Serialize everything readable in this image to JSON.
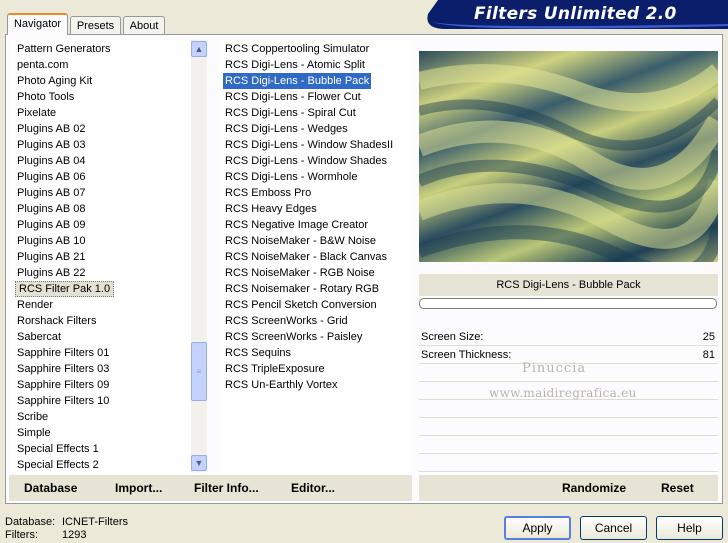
{
  "header": {
    "title": "Filters Unlimited 2.0"
  },
  "tabs": [
    {
      "label": "Navigator",
      "active": true
    },
    {
      "label": "Presets",
      "active": false
    },
    {
      "label": "About",
      "active": false
    }
  ],
  "categories": {
    "items": [
      "Pattern Generators",
      "penta.com",
      "Photo Aging Kit",
      "Photo Tools",
      "Pixelate",
      "Plugins AB 02",
      "Plugins AB 03",
      "Plugins AB 04",
      "Plugins AB 06",
      "Plugins AB 07",
      "Plugins AB 08",
      "Plugins AB 09",
      "Plugins AB 10",
      "Plugins AB 21",
      "Plugins AB 22",
      "RCS Filter Pak 1.0",
      "Render",
      "Rorshack Filters",
      "Sabercat",
      "Sapphire Filters 01",
      "Sapphire Filters 03",
      "Sapphire Filters 09",
      "Sapphire Filters 10",
      "Scribe",
      "Simple",
      "Special Effects 1",
      "Special Effects 2"
    ],
    "selected": "RCS Filter Pak 1.0"
  },
  "filters": {
    "items": [
      "RCS Coppertooling Simulator",
      "RCS Digi-Lens - Atomic Split",
      "RCS Digi-Lens - Bubble Pack",
      "RCS Digi-Lens - Flower Cut",
      "RCS Digi-Lens - Spiral Cut",
      "RCS Digi-Lens - Wedges",
      "RCS Digi-Lens - Window ShadesII",
      "RCS Digi-Lens - Window Shades",
      "RCS Digi-Lens - Wormhole",
      "RCS Emboss Pro",
      "RCS Heavy Edges",
      "RCS Negative Image Creator",
      "RCS NoiseMaker - B&W Noise",
      "RCS NoiseMaker - Black Canvas",
      "RCS NoiseMaker - RGB Noise",
      "RCS Noisemaker - Rotary RGB",
      "RCS Pencil Sketch Conversion",
      "RCS ScreenWorks - Grid",
      "RCS ScreenWorks - Paisley",
      "RCS Sequins",
      "RCS TripleExposure",
      "RCS Un-Earthly Vortex"
    ],
    "selected": "RCS Digi-Lens - Bubble Pack"
  },
  "preview": {
    "filter_name": "RCS Digi-Lens - Bubble Pack"
  },
  "params": [
    {
      "label": "Screen Size:",
      "value": "25"
    },
    {
      "label": "Screen Thickness:",
      "value": "81"
    }
  ],
  "watermark": {
    "line1": "Pinuccia",
    "line2": "www.maidiregrafica.eu"
  },
  "toolbar": {
    "database": "Database",
    "import": "Import...",
    "filter_info": "Filter Info...",
    "editor": "Editor...",
    "randomize": "Randomize",
    "reset": "Reset"
  },
  "status": {
    "database_label": "Database:",
    "database_value": "ICNET-Filters",
    "filters_label": "Filters:",
    "filters_value": "1293"
  },
  "dialog": {
    "apply": "Apply",
    "cancel": "Cancel",
    "help": "Help"
  },
  "colors": {
    "selection": "#316ac5",
    "banner": "#0a246a"
  }
}
